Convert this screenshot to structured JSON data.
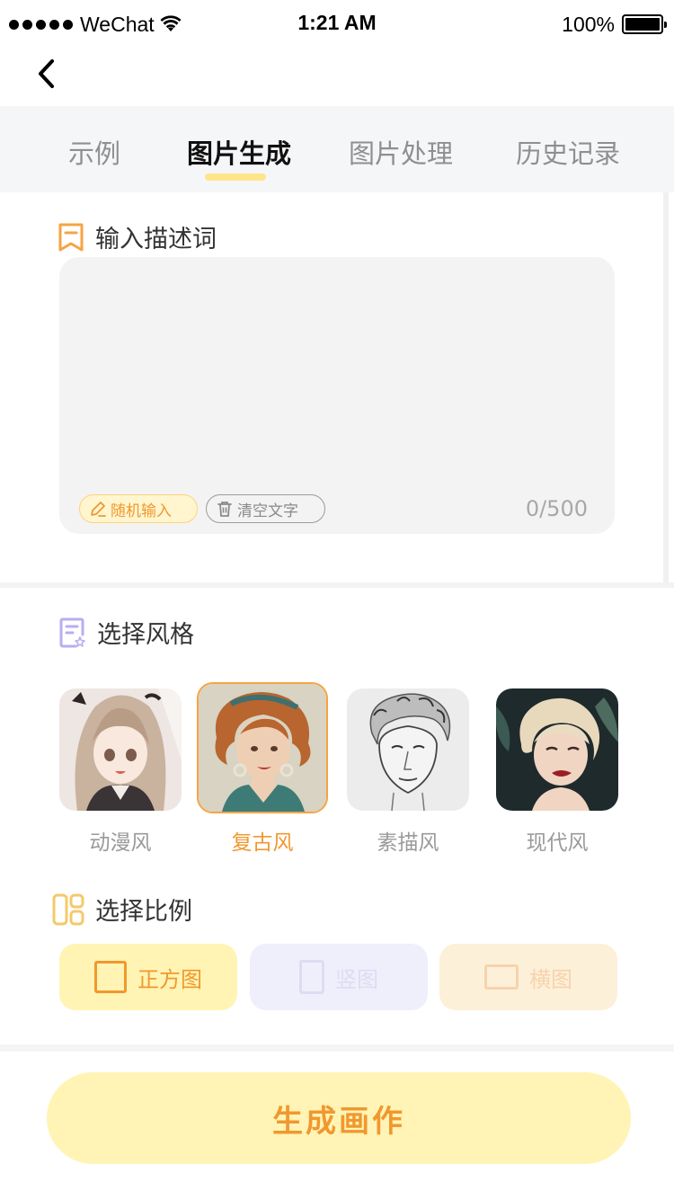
{
  "status_bar": {
    "carrier": "WeChat",
    "time": "1:21 AM",
    "battery": "100%",
    "battery_level": 1.0
  },
  "tabs": [
    {
      "label": "示例",
      "active": false
    },
    {
      "label": "图片生成",
      "active": true
    },
    {
      "label": "图片处理",
      "active": false
    },
    {
      "label": "历史记录",
      "active": false
    }
  ],
  "description": {
    "title": "输入描述词",
    "value": "",
    "random_label": "随机输入",
    "clear_label": "清空文字",
    "counter": "0/500"
  },
  "style": {
    "title": "选择风格",
    "items": [
      {
        "label": "动漫风",
        "selected": false
      },
      {
        "label": "复古风",
        "selected": true
      },
      {
        "label": "素描风",
        "selected": false
      },
      {
        "label": "现代风",
        "selected": false
      }
    ]
  },
  "ratio": {
    "title": "选择比例",
    "items": [
      {
        "label": "正方图",
        "selected": true
      },
      {
        "label": "竖图",
        "selected": false
      },
      {
        "label": "横图",
        "selected": false
      }
    ]
  },
  "generate_label": "生成画作",
  "colors": {
    "accent_orange": "#f0982f",
    "accent_yellow": "#fff4b5",
    "tab_underline": "#ffe58a",
    "purple_icon": "#b9aef0"
  }
}
